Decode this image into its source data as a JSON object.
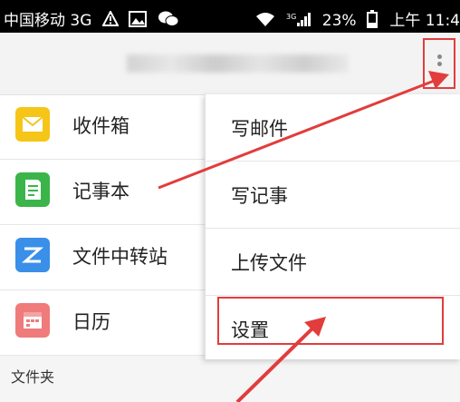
{
  "status_bar": {
    "carrier": "中国移动 3G",
    "battery": "23%",
    "time": "上午 11:4",
    "icons": [
      "warning-icon",
      "image-icon",
      "wechat-icon",
      "wifi-icon",
      "3g-signal-icon",
      "battery-icon"
    ]
  },
  "app_bar": {
    "title_obscured": true,
    "overflow_icon": "more-vert-icon"
  },
  "sidebar": {
    "items": [
      {
        "label": "收件箱",
        "icon": "mail-icon",
        "color": "#f5c518"
      },
      {
        "label": "记事本",
        "icon": "note-icon",
        "color": "#3bb54a"
      },
      {
        "label": "文件中转站",
        "icon": "transfer-icon",
        "color": "#3a8fe8"
      },
      {
        "label": "日历",
        "icon": "calendar-icon",
        "color": "#f07b7b"
      }
    ],
    "section_label": "文件夹"
  },
  "overflow_menu": {
    "items": [
      {
        "label": "写邮件"
      },
      {
        "label": "写记事"
      },
      {
        "label": "上传文件"
      },
      {
        "label": "设置",
        "highlighted": true
      }
    ]
  },
  "annotation": {
    "color": "#e23c3c"
  }
}
